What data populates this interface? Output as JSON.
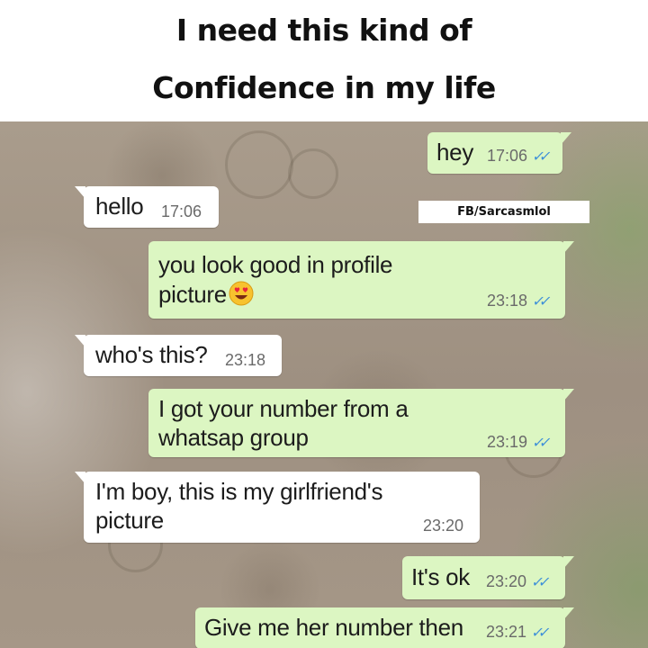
{
  "caption": {
    "line1": "I need this kind of",
    "line2": "Confidence in my life"
  },
  "watermark": "FB/Sarcasmlol",
  "colors": {
    "outgoing_bubble": "#dcf6c2",
    "incoming_bubble": "#ffffff",
    "read_ticks": "#3d8fd8",
    "timestamp": "#6a6a6a"
  },
  "messages": [
    {
      "direction": "outgoing",
      "text": "hey",
      "time": "17:06",
      "status": "read-double-tick-icon"
    },
    {
      "direction": "incoming",
      "text": "hello",
      "time": "17:06"
    },
    {
      "direction": "outgoing",
      "text_line1": "you look good in profile",
      "text_line2": "picture",
      "emoji": "heart-eyes-icon",
      "time": "23:18",
      "status": "read-double-tick-icon"
    },
    {
      "direction": "incoming",
      "text": "who's this?",
      "time": "23:18"
    },
    {
      "direction": "outgoing",
      "text_line1": "I got your number from a",
      "text_line2": "whatsap group",
      "time": "23:19",
      "status": "read-double-tick-icon"
    },
    {
      "direction": "incoming",
      "text_line1": "I'm boy, this is my girlfriend's",
      "text_line2": "picture",
      "time": "23:20"
    },
    {
      "direction": "outgoing",
      "text": "It's ok",
      "time": "23:20",
      "status": "read-double-tick-icon"
    },
    {
      "direction": "outgoing",
      "text": "Give me her number then",
      "time": "23:21",
      "status": "read-double-tick-icon"
    }
  ]
}
